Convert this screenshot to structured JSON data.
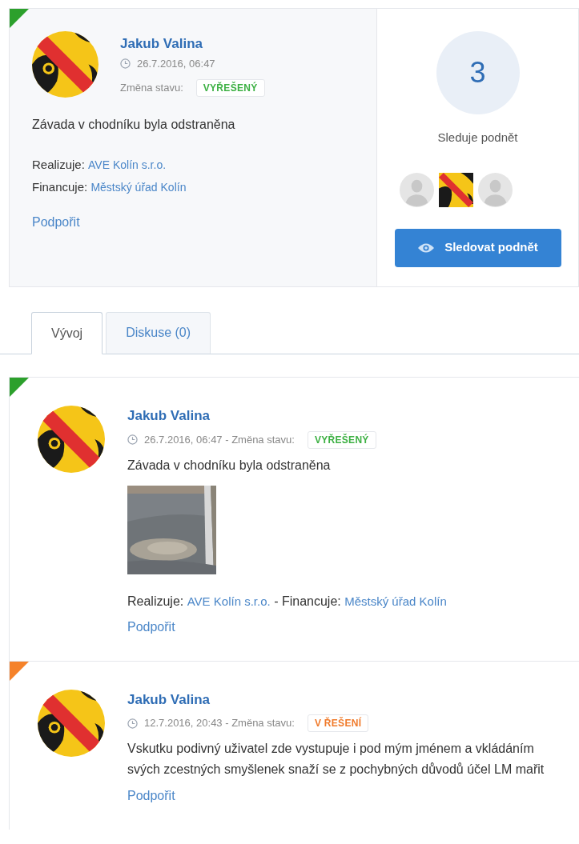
{
  "summary": {
    "author": "Jakub Valina",
    "time": "26.7.2016, 06:47",
    "status_label": "Změna stavu:",
    "status": {
      "text": "VYŘEŠENÝ",
      "kind": "resolved"
    },
    "description": "Závada v chodníku byla odstraněna",
    "implementer": {
      "label": "Realizuje:",
      "value": "AVE Kolín s.r.o."
    },
    "funder": {
      "label": "Financuje:",
      "value": "Městský úřad Kolín"
    },
    "support_link": "Podpořit"
  },
  "followers": {
    "count": "3",
    "label": "Sleduje podnět",
    "avatars": [
      {
        "kind": "default"
      },
      {
        "kind": "picture"
      },
      {
        "kind": "default"
      }
    ],
    "button": "Sledovat podnět"
  },
  "tabs": [
    {
      "label": "Vývoj",
      "selected": true
    },
    {
      "label": "Diskuse (0)",
      "selected": false
    }
  ],
  "timeline": [
    {
      "author": "Jakub Valina",
      "time": "26.7.2016, 06:47 - Změna stavu:",
      "status": {
        "text": "VYŘEŠENÝ",
        "kind": "resolved"
      },
      "text": "Závada v chodníku byla odstraněna",
      "photo": {
        "kind": "picture"
      },
      "implementer": {
        "label": "Realizuje:",
        "value": "AVE Kolín s.r.o."
      },
      "funder": {
        "label": "- Financuje:",
        "value": "Městský úřad Kolín"
      },
      "support_link": "Podpořit"
    },
    {
      "author": "Jakub Valina",
      "time": "12.7.2016, 20:43 - Změna stavu:",
      "status": {
        "text": "V ŘEŠENÍ",
        "kind": "in_progress"
      },
      "text": "Vskutku podivný uživatel zde vystupuje i pod mým jménem a vkládáním svých zcestných smyšlenek snaží se z pochybných důvodů účel LM mařit",
      "support_link": "Podpořit"
    }
  ]
}
